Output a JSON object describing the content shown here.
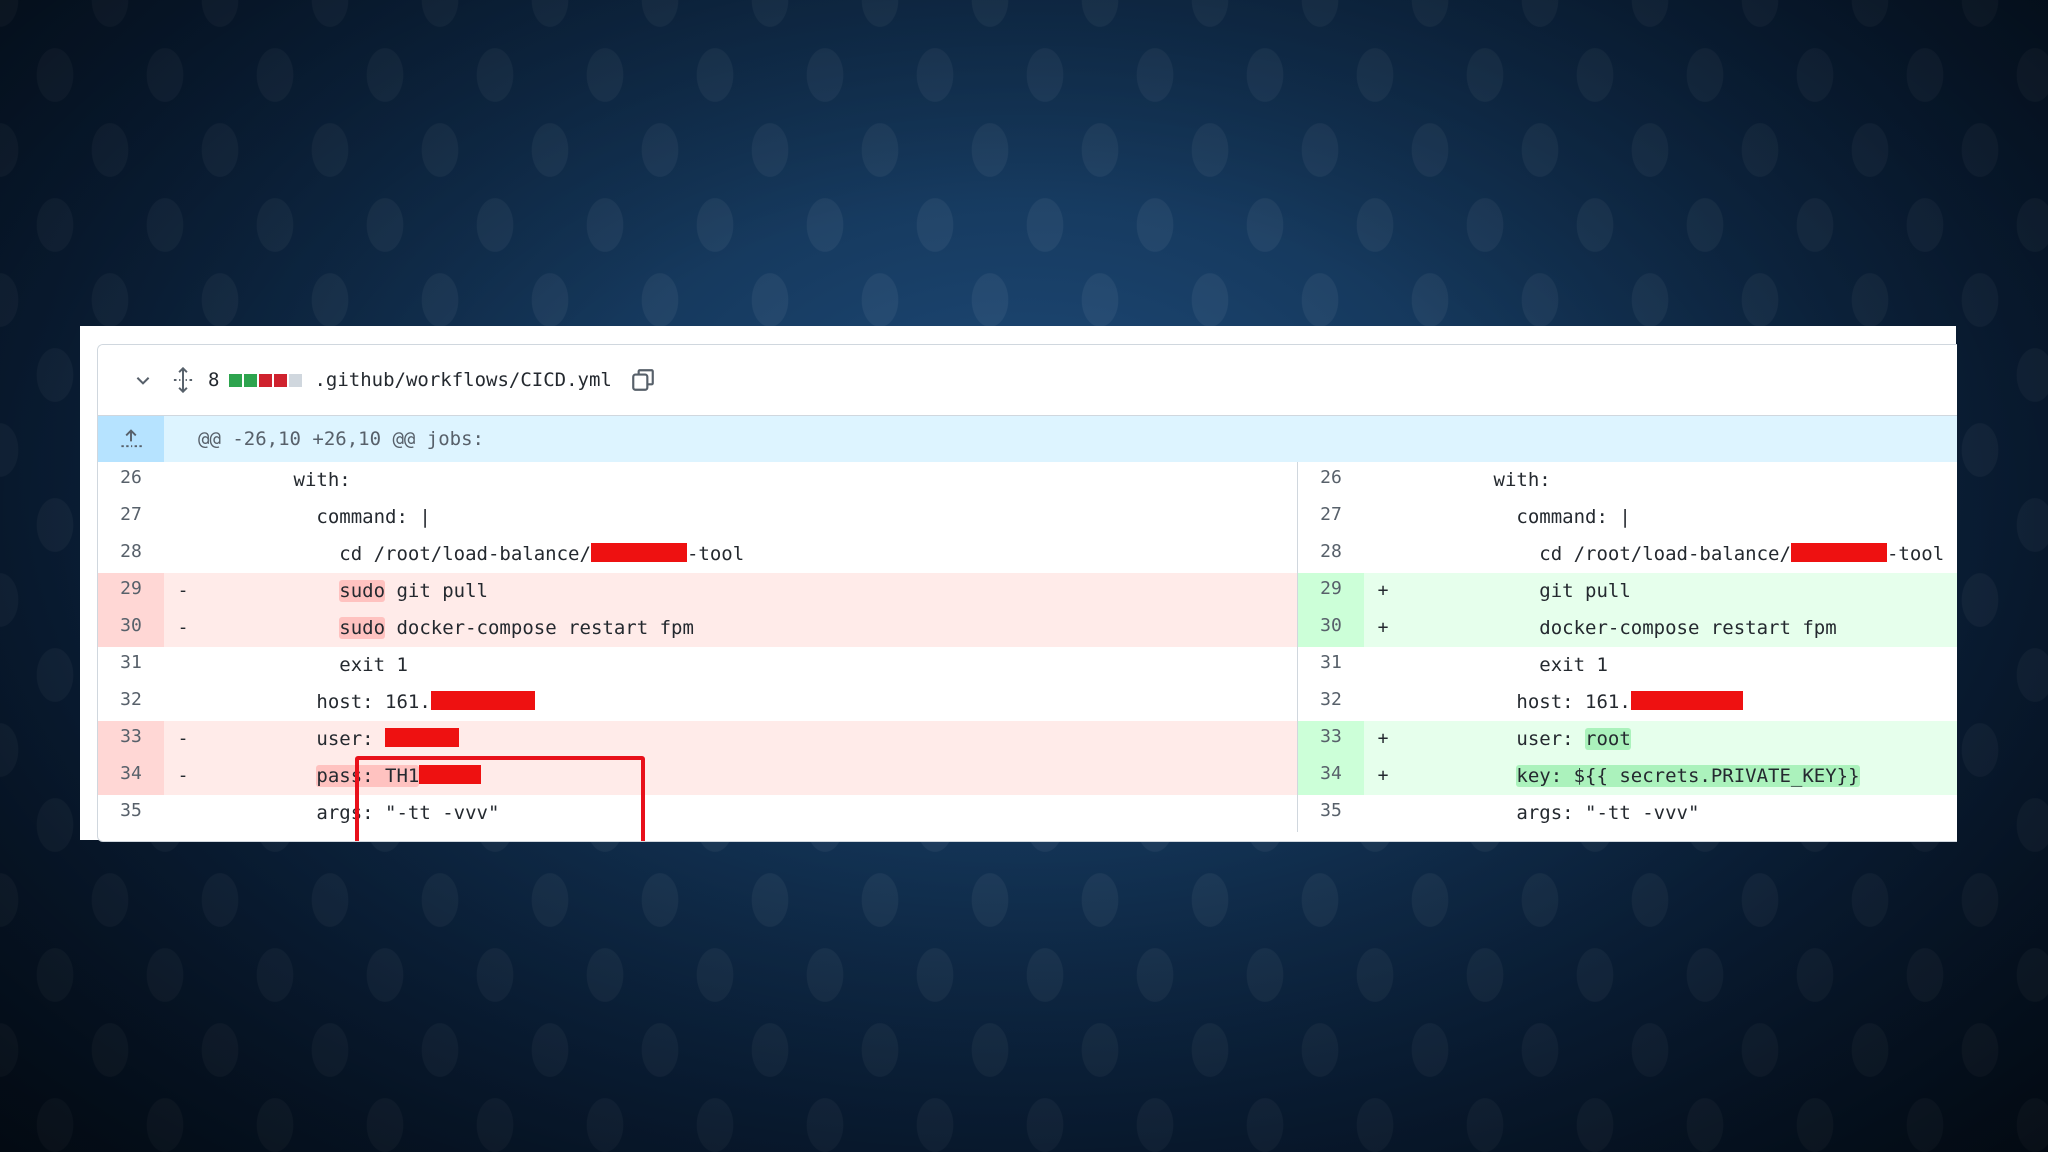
{
  "file": {
    "changes": "8",
    "path": ".github/workflows/CICD.yml",
    "diffstat_colors": [
      "#2da44e",
      "#2da44e",
      "#cf222e",
      "#cf222e",
      "#d0d7de"
    ]
  },
  "hunk": {
    "header": "@@ -26,10 +26,10 @@ jobs:"
  },
  "colors": {
    "redaction": "#ee1111",
    "callout": "#e8101a"
  },
  "rows": [
    {
      "left": {
        "num": "26",
        "marker": "",
        "pre": "        with:"
      },
      "right": {
        "num": "26",
        "marker": "",
        "pre": "        with:"
      }
    },
    {
      "left": {
        "num": "27",
        "marker": "",
        "pre": "          command: |"
      },
      "right": {
        "num": "27",
        "marker": "",
        "pre": "          command: |"
      }
    },
    {
      "left": {
        "num": "28",
        "marker": "",
        "pre": "            cd /root/load-balance/",
        "post": "-tool"
      },
      "right": {
        "num": "28",
        "marker": "",
        "pre": "            cd /root/load-balance/",
        "post": "-tool"
      }
    },
    {
      "left": {
        "num": "29",
        "marker": "-",
        "pre": "            ",
        "hl": "sudo",
        "post": " git pull"
      },
      "right": {
        "num": "29",
        "marker": "+",
        "pre": "            git pull"
      }
    },
    {
      "left": {
        "num": "30",
        "marker": "-",
        "pre": "            ",
        "hl": "sudo",
        "post": " docker-compose restart fpm"
      },
      "right": {
        "num": "30",
        "marker": "+",
        "pre": "            docker-compose restart fpm"
      }
    },
    {
      "left": {
        "num": "31",
        "marker": "",
        "pre": "            exit 1"
      },
      "right": {
        "num": "31",
        "marker": "",
        "pre": "            exit 1"
      }
    },
    {
      "left": {
        "num": "32",
        "marker": "",
        "pre": "          host: 161."
      },
      "right": {
        "num": "32",
        "marker": "",
        "pre": "          host: 161."
      }
    },
    {
      "left": {
        "num": "33",
        "marker": "-",
        "pre": "          user: "
      },
      "right": {
        "num": "33",
        "marker": "+",
        "pre": "          user: ",
        "hl": "root"
      }
    },
    {
      "left": {
        "num": "34",
        "marker": "-",
        "pre": "          ",
        "hl": "pass: TH1"
      },
      "right": {
        "num": "34",
        "marker": "+",
        "pre": "          ",
        "hl": "key: ${{ secrets.PRIVATE_KEY}}"
      }
    },
    {
      "left": {
        "num": "35",
        "marker": "",
        "pre": "          args: \"-tt -vvv\""
      },
      "right": {
        "num": "35",
        "marker": "",
        "pre": "          args: \"-tt -vvv\""
      }
    }
  ]
}
